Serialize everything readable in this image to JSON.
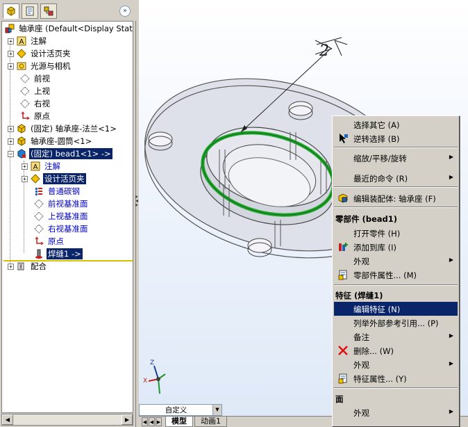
{
  "feature_tree": {
    "root": {
      "label": "轴承座 (Default<Display State-1"
    },
    "nodes": [
      {
        "label": "注解"
      },
      {
        "label": "设计活页夹"
      },
      {
        "label": "光源与相机"
      },
      {
        "label": "前视"
      },
      {
        "label": "上视"
      },
      {
        "label": "右视"
      },
      {
        "label": "原点"
      },
      {
        "label": "(固定) 轴承座-法兰<1>"
      },
      {
        "label": "轴承座-圆筒<1>"
      },
      {
        "label": "(固定) bead1<1> ->"
      },
      {
        "label": "注解"
      },
      {
        "label": "设计活页夹"
      },
      {
        "label": "普通碳钢"
      },
      {
        "label": "前视基准面"
      },
      {
        "label": "上视基准面"
      },
      {
        "label": "右视基准面"
      },
      {
        "label": "原点"
      },
      {
        "label": "焊缝1 ->"
      },
      {
        "label": "配合"
      }
    ]
  },
  "viewport": {
    "weld_symbol_text": "2",
    "triad": {
      "y": "Y",
      "x": "X",
      "z": "Z"
    },
    "config_combo": "自定义"
  },
  "bottom_tabs": [
    "模型",
    "动画1"
  ],
  "context_menu": {
    "items_top": [
      {
        "label": "选择其它 (A)"
      },
      {
        "label": "逆转选择 (B)"
      },
      {
        "label": "缩放/平移/旋转"
      },
      {
        "label": "最近的命令 (R)"
      },
      {
        "label": "编辑装配体: 轴承座 (F)"
      }
    ],
    "section_component": "零部件 (bead1)",
    "items_component": [
      {
        "label": "打开零件 (H)"
      },
      {
        "label": "添加到库 (I)"
      },
      {
        "label": "外观"
      },
      {
        "label": "零部件属性... (M)"
      }
    ],
    "section_feature": "特征 (焊缝1)",
    "items_feature": [
      {
        "label": "编辑特征 (N)"
      },
      {
        "label": "列举外部参考引用... (P)"
      },
      {
        "label": "备注"
      },
      {
        "label": "删除... (W)"
      },
      {
        "label": "外观"
      },
      {
        "label": "特征属性... (Y)"
      }
    ],
    "section_face": "面",
    "items_face": [
      {
        "label": "外观"
      }
    ]
  },
  "colors": {
    "selection": "#0a246a",
    "weld_bead": "#1fa52a",
    "viewport_bg": "#ecf2fb"
  }
}
